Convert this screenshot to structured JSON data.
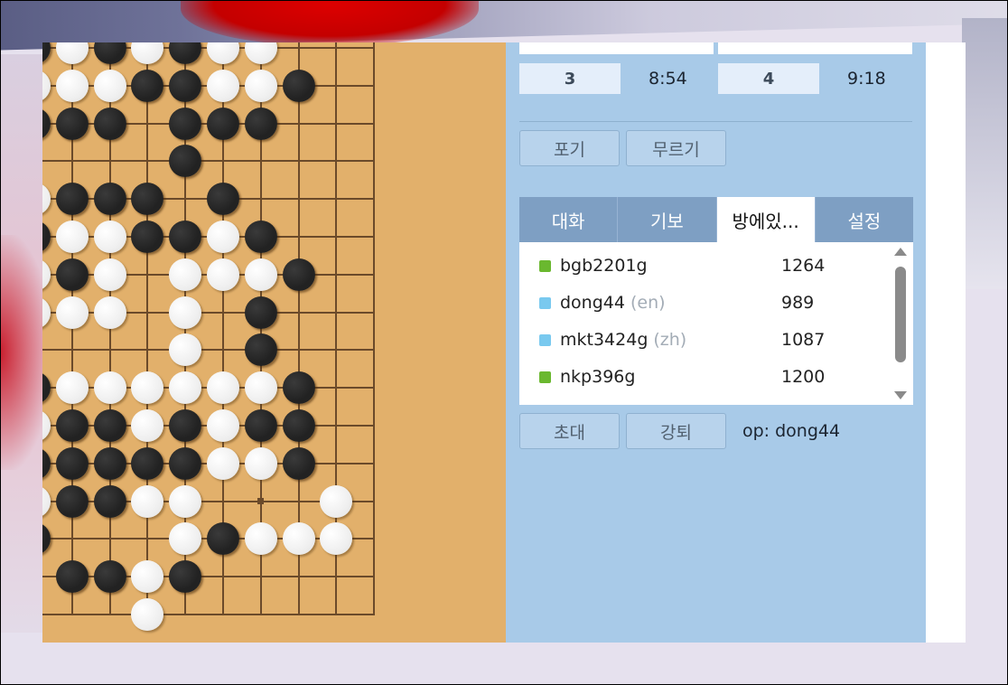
{
  "scoreboard": {
    "player1": {
      "captures": "3",
      "time": "8:54"
    },
    "player2": {
      "captures": "4",
      "time": "9:18"
    }
  },
  "actions": {
    "resign": "포기",
    "undo": "무르기"
  },
  "tabs": [
    {
      "label": "대화"
    },
    {
      "label": "기보"
    },
    {
      "label": "방에있..."
    },
    {
      "label": "설정"
    }
  ],
  "users": [
    {
      "name": "bgb2201g",
      "lang": "",
      "rating": "1264",
      "color": "#6ab82f"
    },
    {
      "name": "dong44",
      "lang": "(en)",
      "rating": "989",
      "color": "#79c9ef"
    },
    {
      "name": "mkt3424g",
      "lang": "(zh)",
      "rating": "1087",
      "color": "#79c9ef"
    },
    {
      "name": "nkp396g",
      "lang": "",
      "rating": "1200",
      "color": "#6ab82f"
    }
  ],
  "room_actions": {
    "invite": "초대",
    "kick": "강퇴",
    "op_label": "op: dong44"
  },
  "board": {
    "stones": [
      "BWBWBWW...",
      "WWWBBWWB..",
      "BBB.BBB...",
      "....B.....",
      "WBBB.B....",
      "BWWBBWB...",
      "WBW.WWWB..",
      "WWW.W.B...",
      "....W.B...",
      "BWWWWWWB..",
      "WBBWBWBB..",
      "BBBBBWWB..",
      "WBBWW...W.",
      "B...WBWWW.",
      ".BBWB.....",
      "...W......"
    ]
  }
}
